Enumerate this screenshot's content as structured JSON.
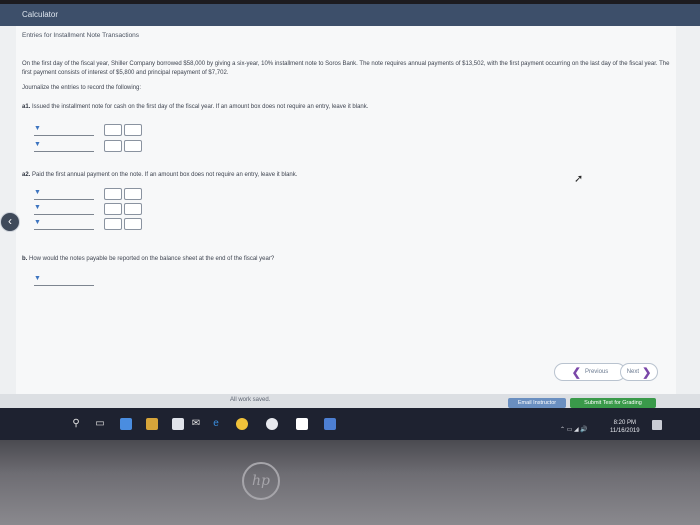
{
  "app": {
    "title": "Calculator"
  },
  "page": {
    "title": "Entries for Installment Note Transactions",
    "intro": "On the first day of the fiscal year, Shiller Company borrowed $58,000 by giving a six-year, 10% installment note to Soros Bank. The note requires annual payments of $13,502, with the first payment occurring on the last day of the fiscal year. The first payment consists of interest of $5,800 and principal repayment of $7,702.",
    "journalize": "Journalize the entries to record the following:"
  },
  "questions": {
    "a1": {
      "label": "a1.",
      "text": "Issued the installment note for cash on the first day of the fiscal year. If an amount box does not require an entry, leave it blank."
    },
    "a2": {
      "label": "a2.",
      "text": "Paid the first annual payment on the note. If an amount box does not require an entry, leave it blank."
    },
    "b": {
      "label": "b.",
      "text": "How would the notes payable be reported on the balance sheet at the end of the fiscal year?"
    }
  },
  "navigation": {
    "previous": "Previous",
    "next": "Next"
  },
  "footer": {
    "saved": "All work saved.",
    "email_instructor": "Email Instructor",
    "submit": "Submit Test for Grading"
  },
  "taskbar": {
    "time": "8:20 PM",
    "date": "11/16/2019"
  },
  "colors": {
    "titlebar": "#3d4f6a",
    "accent": "#3c74c0",
    "submit": "#3a9a4a",
    "email": "#6a8fc0"
  }
}
